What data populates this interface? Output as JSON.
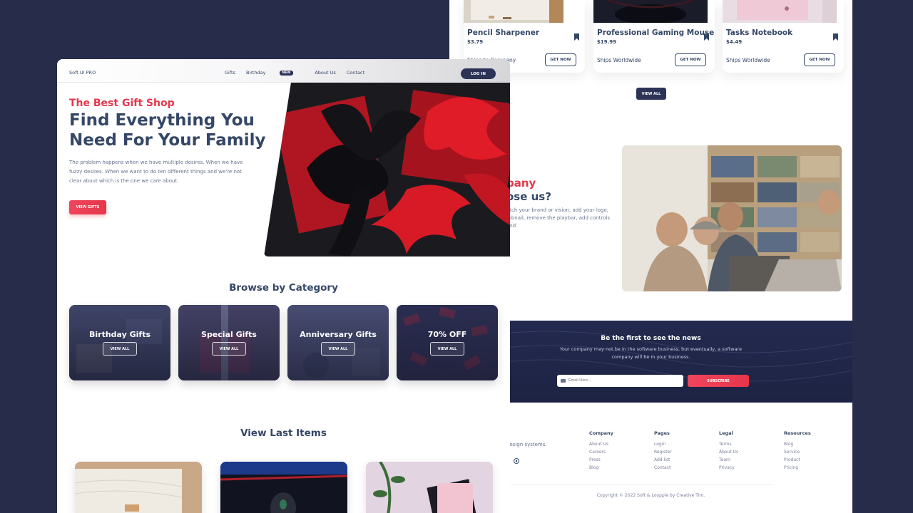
{
  "back": {
    "products": [
      {
        "name": "Pencil Sharpener",
        "price": "$3.79",
        "ship": "Ships to Company",
        "cta": "GET NOW"
      },
      {
        "name": "Professional Gaming Mouse",
        "price": "$19.99",
        "ship": "Ships Worldwide",
        "cta": "GET NOW"
      },
      {
        "name": "Tasks Notebook",
        "price": "$4.49",
        "ship": "Ships Worldwide",
        "cta": "GET NOW"
      }
    ],
    "view_all": "VIEW ALL",
    "why": {
      "title_accent": "pany",
      "title_main": "ose us?",
      "desc": "atch your brand or vision, add your logo, mbnail, remove the playbar, add controls and"
    },
    "newsletter": {
      "title": "Be the first to see the news",
      "desc": "Your company may not be in the software business, but eventually, a software company will be in your business.",
      "email_placeholder": "Email Here...",
      "subscribe": "SUBSCRIBE"
    },
    "footer": {
      "tagline_fragment": "design systems.",
      "columns": [
        {
          "heading": "Company",
          "items": [
            "About Us",
            "Careers",
            "Press",
            "Blog"
          ]
        },
        {
          "heading": "Pages",
          "items": [
            "Login",
            "Register",
            "Add list",
            "Contact"
          ]
        },
        {
          "heading": "Legal",
          "items": [
            "Terms",
            "About Us",
            "Team",
            "Privacy"
          ]
        },
        {
          "heading": "Resources",
          "items": [
            "Blog",
            "Service",
            "Product",
            "Pricing"
          ]
        }
      ],
      "copyright": "Copyright © 2022 Soft & Loopple by Creative Tim."
    }
  },
  "front": {
    "nav": {
      "brand": "Soft UI PRO",
      "links": [
        "Gifts",
        "Birthday",
        "About Us",
        "Contact"
      ],
      "badge": "NEW",
      "login": "LOG IN"
    },
    "hero": {
      "subtitle": "The Best Gift Shop",
      "title": "Find Everything You Need For Your Family",
      "desc": "The problem happens when we have multiple desires. When we have fuzzy desires. When we want to do ten different things and we're not clear about which is the one we care about.",
      "cta": "VIEW GIFTS"
    },
    "categories_title": "Browse by Category",
    "categories": [
      {
        "name": "Birthday Gifts",
        "cta": "VIEW ALL"
      },
      {
        "name": "Special Gifts",
        "cta": "VIEW ALL"
      },
      {
        "name": "Anniversary Gifts",
        "cta": "VIEW ALL"
      },
      {
        "name": "70% OFF",
        "cta": "VIEW ALL"
      }
    ],
    "last_items_title": "View Last Items"
  },
  "colors": {
    "background": "#262c4a",
    "accent": "#e6364a",
    "dark": "#2c3357",
    "text": "#344767"
  }
}
